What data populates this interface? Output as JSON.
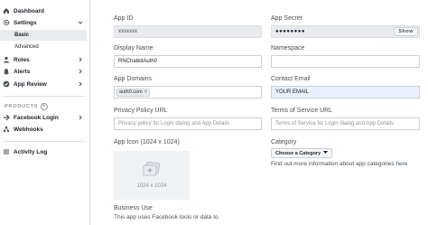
{
  "sidebar": {
    "dashboard": "Dashboard",
    "settings": "Settings",
    "basic": "Basic",
    "advanced": "Advanced",
    "roles": "Roles",
    "alerts": "Alerts",
    "app_review": "App Review",
    "products_heading": "PRODUCTS",
    "facebook_login": "Facebook Login",
    "webhooks": "Webhooks",
    "activity_log": "Activity Log"
  },
  "form": {
    "app_id_label": "App ID",
    "app_id_value": "xxxxxxx",
    "app_secret_label": "App Secret",
    "app_secret_value": "●●●●●●●●",
    "show_label": "Show",
    "display_name_label": "Display Name",
    "display_name_value": "RNChatkitAuth0",
    "namespace_label": "Namespace",
    "namespace_value": "",
    "app_domains_label": "App Domains",
    "app_domain_tag": "auth0.com",
    "contact_email_label": "Contact Email",
    "contact_email_value": "YOUR EMAIL",
    "privacy_label": "Privacy Policy URL",
    "privacy_placeholder": "Privacy policy for Login dialog and App Details",
    "tos_label": "Terms of Service URL",
    "tos_placeholder": "Terms of Service for Login dialog and App Details",
    "app_icon_label": "App Icon (1024 x 1024)",
    "app_icon_size": "1024 x 1024",
    "category_label": "Category",
    "category_button": "Choose a Category",
    "category_info_prefix": "Find out more information about app categories ",
    "category_info_link": "here",
    "business_use_label": "Business Use",
    "business_use_text": "This app uses Facebook tools or data to"
  }
}
